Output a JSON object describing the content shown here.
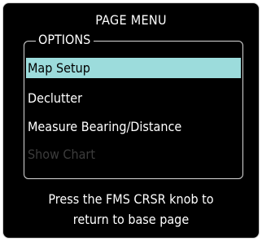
{
  "window": {
    "title": "PAGE MENU"
  },
  "options": {
    "label": "OPTIONS",
    "items": [
      {
        "label": "Map Setup",
        "selected": true,
        "enabled": true
      },
      {
        "label": "Declutter",
        "selected": false,
        "enabled": true
      },
      {
        "label": "Measure Bearing/Distance",
        "selected": false,
        "enabled": true
      },
      {
        "label": "Show Chart",
        "selected": false,
        "enabled": false
      }
    ]
  },
  "footer": {
    "line1": "Press the FMS CRSR knob to",
    "line2": "return to base page"
  },
  "colors": {
    "background": "#000000",
    "text": "#ffffff",
    "highlight": "#9cdcdc",
    "disabled_text": "#3c3c3c",
    "border": "#cfcfcf"
  }
}
